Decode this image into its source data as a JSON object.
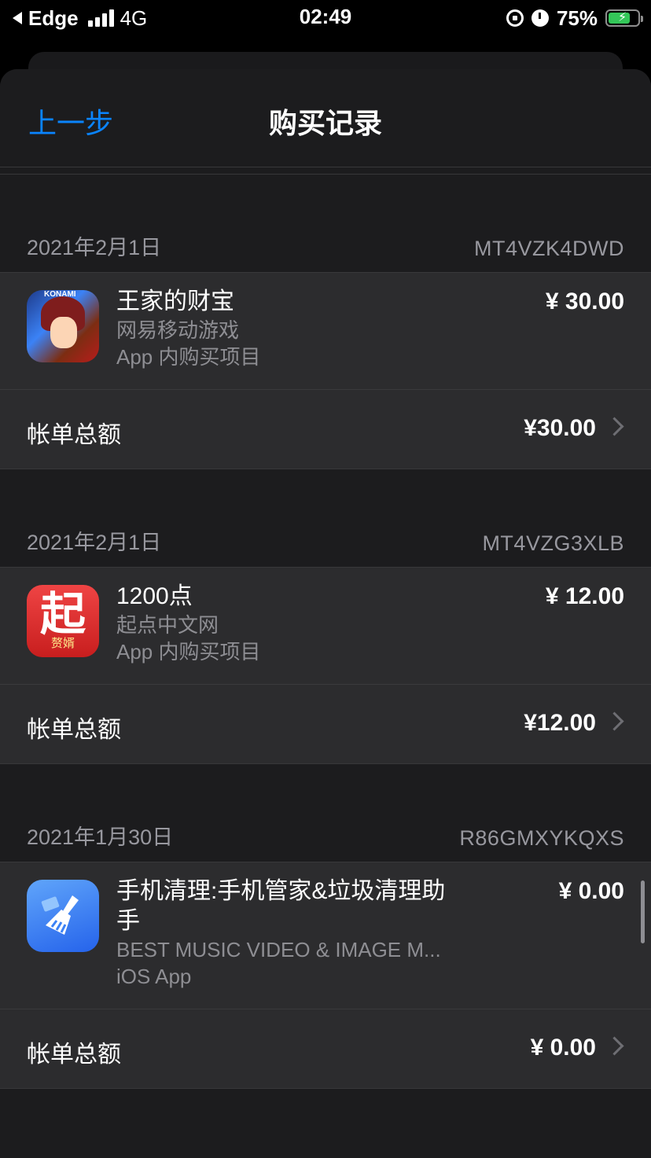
{
  "status_bar": {
    "carrier": "Edge",
    "network": "4G",
    "time": "02:49",
    "battery": "75%",
    "battery_level": 0.75
  },
  "nav": {
    "back_label": "上一步",
    "title": "购买记录"
  },
  "purchases": [
    {
      "date": "2021年2月1日",
      "order_id": "MT4VZK4DWD",
      "item_title": "王家的财宝",
      "item_developer": "网易移动游戏",
      "item_type": "App 内购买项目",
      "item_price": "¥ 30.00",
      "total_label": "帐单总额",
      "total_value": "¥30.00",
      "icon": "yugioh-app-icon"
    },
    {
      "date": "2021年2月1日",
      "order_id": "MT4VZG3XLB",
      "item_title": "1200点",
      "item_developer": "起点中文网",
      "item_type": "App 内购买项目",
      "item_price": "¥ 12.00",
      "total_label": "帐单总额",
      "total_value": "¥12.00",
      "icon": "qidian-app-icon",
      "icon_text": "起",
      "icon_subtext": "赘婿"
    },
    {
      "date": "2021年1月30日",
      "order_id": "R86GMXYKQXS",
      "item_title": "手机清理:手机管家&垃圾清理助手",
      "item_developer": "BEST MUSIC VIDEO & IMAGE M...",
      "item_type": "iOS App",
      "item_price": "¥ 0.00",
      "total_label": "帐单总额",
      "total_value": "¥ 0.00",
      "icon": "cleaner-app-icon"
    }
  ],
  "colors": {
    "accent": "#0a84ff",
    "sheet_bg": "#1c1c1e",
    "card_bg": "#2c2c2e",
    "secondary_text": "#8e8e93",
    "battery_green": "#34c759"
  }
}
